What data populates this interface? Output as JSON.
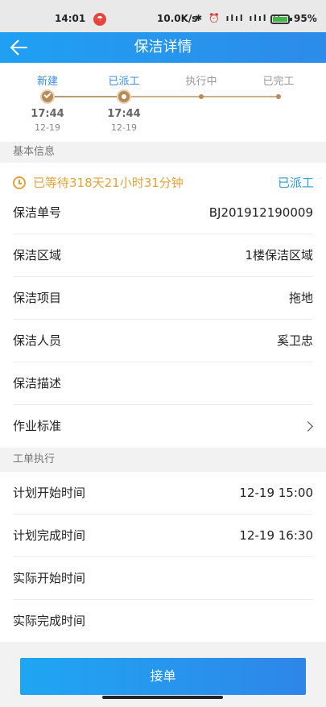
{
  "status_bar": {
    "time": "14:01",
    "notification_badge": "☂",
    "net_speed": "10.0K/s",
    "icons_text": "✱ ⏰ ılıl ılıl ⌔",
    "battery_level": 95,
    "battery_text": "95%"
  },
  "header": {
    "title": "保洁详情"
  },
  "steps": [
    {
      "label": "新建",
      "state": "done",
      "time": "17:44",
      "date": "12-19"
    },
    {
      "label": "已派工",
      "state": "current",
      "time": "17:44",
      "date": "12-19"
    },
    {
      "label": "执行中",
      "state": "pending",
      "time": "",
      "date": ""
    },
    {
      "label": "已完工",
      "state": "pending",
      "time": "",
      "date": ""
    }
  ],
  "basic_info": {
    "section_title": "基本信息",
    "wait_text": "已等待318天21小时31分钟",
    "status_tag": "已派工",
    "rows": [
      {
        "label": "保洁单号",
        "value": "BJ201912190009"
      },
      {
        "label": "保洁区域",
        "value": "1楼保洁区域"
      },
      {
        "label": "保洁项目",
        "value": "拖地"
      },
      {
        "label": "保洁人员",
        "value": "奚卫忠"
      },
      {
        "label": "保洁描述",
        "value": ""
      },
      {
        "label": "作业标准",
        "value": ""
      }
    ]
  },
  "execution": {
    "section_title": "工单执行",
    "rows": [
      {
        "label": "计划开始时间",
        "value": "12-19 15:00"
      },
      {
        "label": "计划完成时间",
        "value": "12-19 16:30"
      },
      {
        "label": "实际开始时间",
        "value": ""
      },
      {
        "label": "实际完成时间",
        "value": ""
      }
    ]
  },
  "actions": {
    "accept_label": "接单"
  },
  "colors": {
    "primary": "#2d8be9",
    "warning": "#e2a33a",
    "progress": "#b88a58"
  }
}
